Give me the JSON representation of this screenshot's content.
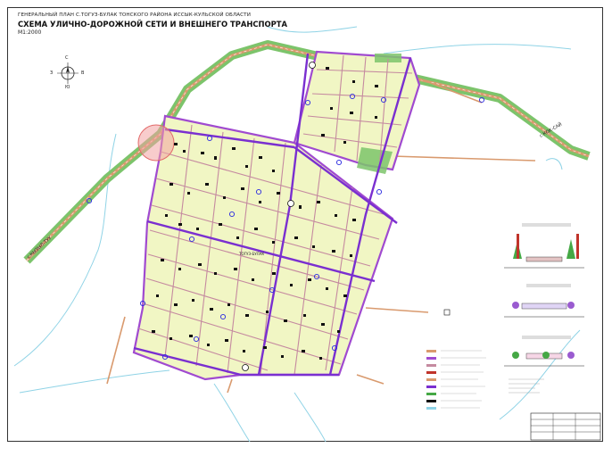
{
  "title": {
    "subtitle": "ГЕНЕРАЛЬНЫЙ ПЛАН с.ТОГУЗ-БУЛАК ТОНСКОГО РАЙОНА ИССЫК-КУЛЬСКОЙ ОБЛАСТИ",
    "main": "СХЕМА УЛИЧНО-ДОРОЖНОЙ СЕТИ И ВНЕШНЕГО ТРАНСПОРТА",
    "scale": "М1:2000"
  },
  "compass": {
    "north": "С",
    "south": "Ю",
    "west": "З",
    "east": "В"
  },
  "road_labels": {
    "kok_sai": "с.КОК-САЙ",
    "kyzyl_tuu": "с.КЫЗЫЛ-ТУУ",
    "village": "ТОГУЗ-БУЛАК"
  },
  "colors": {
    "residential": "#f1f6c4",
    "green_strip": "#7cc46b",
    "main_street": "#a04ad0",
    "highway": "#d99a6e",
    "street": "#c58aa0",
    "buildings": "#111111",
    "water": "#8fd3e6"
  },
  "legend_count": 9,
  "profiles": [
    "profile-1",
    "profile-2",
    "profile-3"
  ]
}
